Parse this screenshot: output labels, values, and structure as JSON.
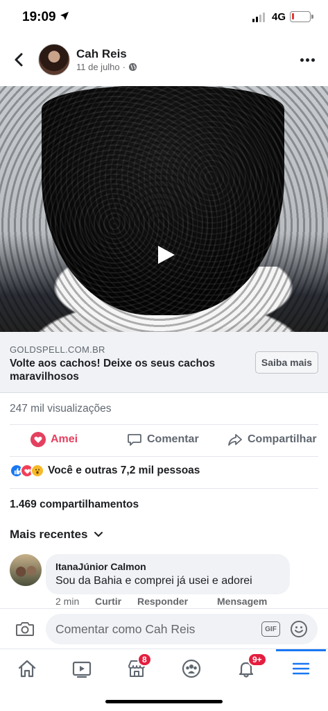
{
  "status_bar": {
    "time": "19:09",
    "network": "4G",
    "battery_level": 0.15
  },
  "header": {
    "author": "Cah Reis",
    "date": "11 de julho",
    "separator": "·",
    "icons": [
      "back-icon",
      "globe-icon",
      "more-icon"
    ]
  },
  "video": {
    "icon": "play-icon"
  },
  "link_card": {
    "domain": "GOLDSPELL.COM.BR",
    "title": "Volte aos cachos! Deixe os seus cachos maravilhosos",
    "button_label": "Saiba mais"
  },
  "stats": {
    "views": "247 mil visualizações",
    "reactions": "Você e outras 7,2 mil pessoas",
    "shares": "1.469 compartilhamentos"
  },
  "actions": {
    "love_label": "Amei",
    "comment_label": "Comentar",
    "share_label": "Compartilhar",
    "love_color": "#e4405f"
  },
  "comments": {
    "sort_label": "Mais recentes",
    "items": [
      {
        "author": "ItanaJúnior Calmon",
        "text": "Sou da Bahia e comprei já usei e adorei",
        "time": "2 min",
        "like_label": "Curtir",
        "reply_label": "Responder",
        "message_label": "Mensagem"
      }
    ]
  },
  "composer": {
    "placeholder": "Comentar como Cah Reis",
    "gif_label": "GIF"
  },
  "tabbar": {
    "tabs": [
      {
        "name": "home-icon"
      },
      {
        "name": "watch-icon"
      },
      {
        "name": "marketplace-icon",
        "badge": "8"
      },
      {
        "name": "groups-icon"
      },
      {
        "name": "notifications-icon",
        "badge": "9+"
      },
      {
        "name": "menu-icon",
        "active": true
      }
    ],
    "accent": "#1877f2",
    "badge_color": "#e41e3f"
  }
}
